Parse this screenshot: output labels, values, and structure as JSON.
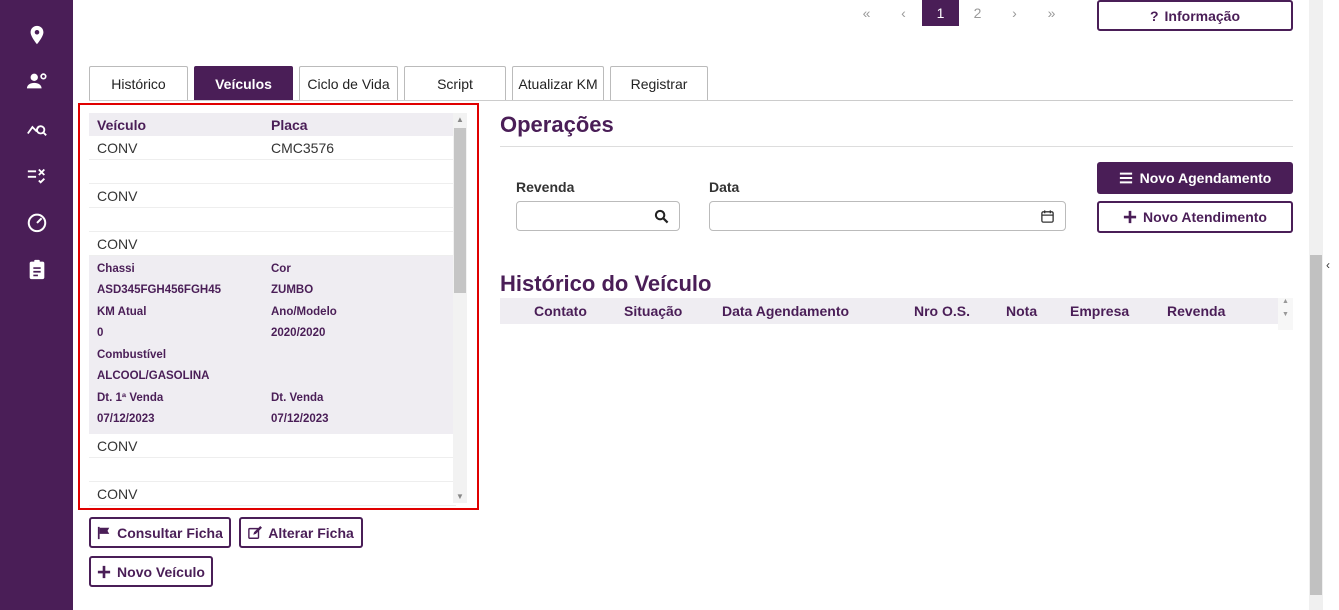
{
  "sidebar": {
    "icons": [
      "map-pin-icon",
      "users-gear-icon",
      "chart-search-icon",
      "list-check-icon",
      "gauge-icon",
      "clipboard-icon"
    ]
  },
  "pagination": {
    "first": "«",
    "prev": "‹",
    "pages": [
      "1",
      "2"
    ],
    "current": "1",
    "next": "›",
    "last": "»"
  },
  "info_button": {
    "icon": "?",
    "label": "Informação"
  },
  "tabs": [
    {
      "label": "Histórico",
      "active": false
    },
    {
      "label": "Veículos",
      "active": true
    },
    {
      "label": "Ciclo de Vida",
      "active": false
    },
    {
      "label": "Script",
      "active": false
    },
    {
      "label": "Atualizar KM",
      "active": false
    },
    {
      "label": "Registrar",
      "active": false
    }
  ],
  "vehicles": {
    "header": {
      "veiculo": "Veículo",
      "placa": "Placa"
    },
    "rows": [
      {
        "veiculo": "CONV",
        "placa": "CMC3576"
      },
      {
        "veiculo": "",
        "placa": ""
      },
      {
        "veiculo": "CONV",
        "placa": ""
      },
      {
        "veiculo": "",
        "placa": ""
      },
      {
        "veiculo": "CONV",
        "placa": ""
      }
    ],
    "detail": {
      "chassi_label": "Chassi",
      "chassi": "ASD345FGH456FGH45",
      "cor_label": "Cor",
      "cor": "ZUMBO",
      "km_label": "KM Atual",
      "km": "0",
      "ano_label": "Ano/Modelo",
      "ano": "2020/2020",
      "combustivel_label": "Combustível",
      "combustivel": "ALCOOL/GASOLINA",
      "dt1_label": "Dt. 1ª Venda",
      "dt1": "07/12/2023",
      "dtv_label": "Dt. Venda",
      "dtv": "07/12/2023"
    },
    "rows_after": [
      {
        "veiculo": "CONV",
        "placa": ""
      },
      {
        "veiculo": "",
        "placa": ""
      },
      {
        "veiculo": "CONV",
        "placa": ""
      }
    ]
  },
  "vehicle_buttons": {
    "consultar": "Consultar Ficha",
    "alterar": "Alterar Ficha",
    "novo": "Novo Veículo"
  },
  "operacoes": {
    "title": "Operações",
    "revenda_label": "Revenda",
    "revenda_value": "",
    "data_label": "Data",
    "data_value": "",
    "novo_agendamento": "Novo Agendamento",
    "novo_atendimento": "Novo Atendimento"
  },
  "historico": {
    "title": "Histórico do Veículo",
    "columns": [
      "Contato",
      "Situação",
      "Data Agendamento",
      "Nro O.S.",
      "Nota",
      "Empresa",
      "Revenda"
    ]
  }
}
